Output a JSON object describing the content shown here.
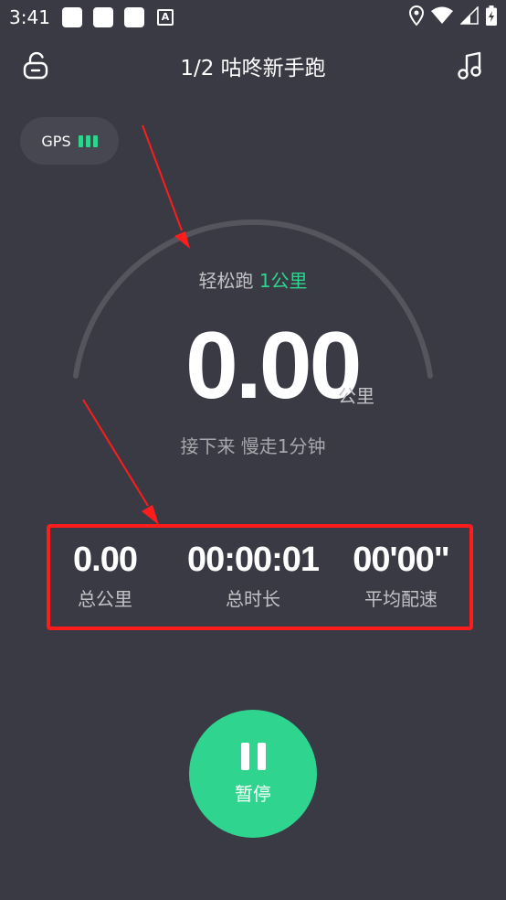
{
  "status_bar": {
    "time": "3:41",
    "notification_icons": [
      "square-icon",
      "square-icon",
      "square-icon",
      "a-icon"
    ],
    "system_icons": [
      "location-icon",
      "wifi-icon",
      "signal-icon",
      "battery-icon"
    ]
  },
  "topbar": {
    "title": "1/2 咕咚新手跑",
    "left_icon": "lock-icon",
    "right_icon": "music-note-icon"
  },
  "gps": {
    "label": "GPS",
    "bars": 3
  },
  "workout": {
    "type": "轻松跑",
    "target": "1公里"
  },
  "distance": {
    "value": "0.00",
    "unit": "公里"
  },
  "hint": "接下来 慢走1分钟",
  "stats": [
    {
      "value": "0.00",
      "label": "总公里"
    },
    {
      "value": "00:00:01",
      "label": "总时长"
    },
    {
      "value": "00'00\"",
      "label": "平均配速"
    }
  ],
  "pause_button": {
    "label": "暂停"
  },
  "colors": {
    "background": "#3a3a44",
    "accent": "#2fd58e",
    "annotation": "#ff1c1c"
  }
}
